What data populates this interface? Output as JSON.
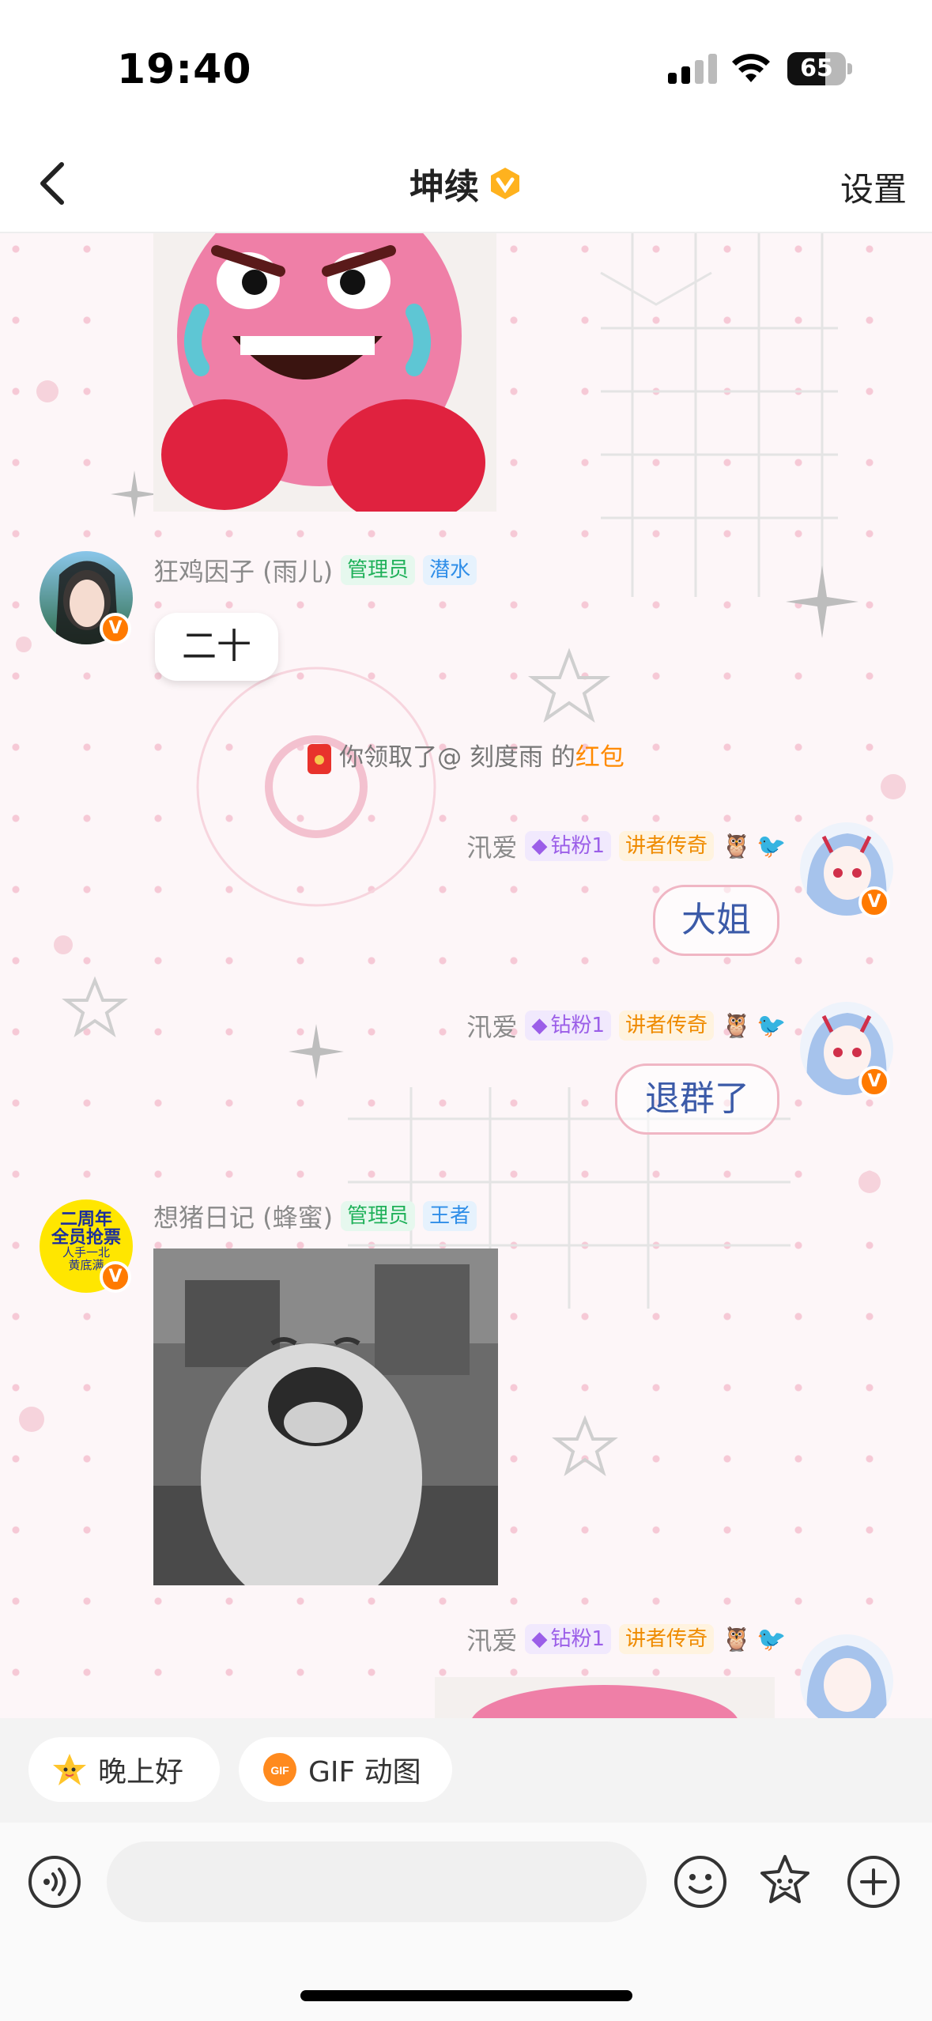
{
  "status_bar": {
    "time": "19:40",
    "battery": "65",
    "battery_level": 0.65
  },
  "header": {
    "title": "坤续",
    "settings_label": "设置"
  },
  "messages": {
    "m1": {
      "nickname": "狂鸡因子 (雨儿)",
      "tag_admin": "管理员",
      "tag_level": "潜水",
      "text": "二十"
    },
    "system": {
      "prefix": "你领取了",
      "mention": "@ 刻度雨",
      "middle": " 的",
      "highlight": "红包"
    },
    "m2": {
      "nickname": "汛爱",
      "tag_fans": "钻粉1",
      "tag_title": "讲者传奇",
      "text": "大姐"
    },
    "m3": {
      "nickname": "汛爱",
      "tag_fans": "钻粉1",
      "tag_title": "讲者传奇",
      "text": "退群了"
    },
    "m4": {
      "nickname": "想猪日记 (蜂蜜)",
      "tag_admin": "管理员",
      "tag_level": "王者",
      "avatar_text": [
        "二周年",
        "全员抢票",
        "人手一北",
        "黄底满"
      ]
    },
    "m5": {
      "nickname": "汛爱",
      "tag_fans": "钻粉1",
      "tag_title": "讲者传奇"
    }
  },
  "quick_replies": [
    {
      "label": "晚上好",
      "icon": "star-face-icon"
    },
    {
      "label": "GIF 动图",
      "icon": "gif-icon"
    }
  ],
  "input": {
    "placeholder": ""
  },
  "colors": {
    "accent": "#ff7a00",
    "admin_green": "#20b15a",
    "bubble_border": "#f0b6c4"
  }
}
